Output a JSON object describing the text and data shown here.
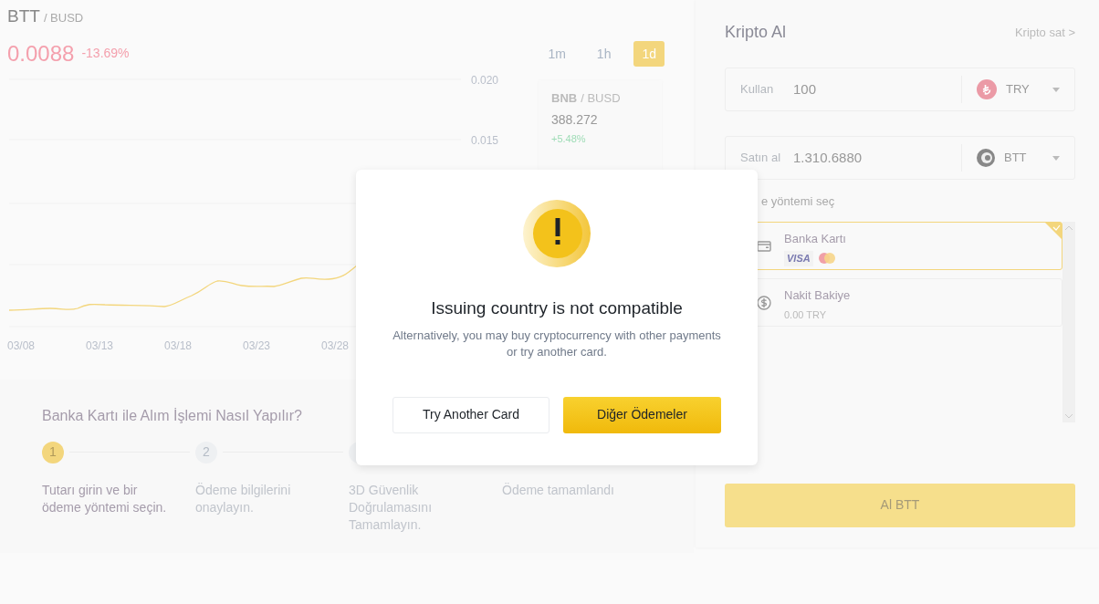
{
  "pair": {
    "base": "BTT",
    "quote": "/ BUSD",
    "price": "0.0088",
    "change": "-13.69%"
  },
  "intervals": [
    {
      "label": "1m",
      "selected": false
    },
    {
      "label": "1h",
      "selected": false
    },
    {
      "label": "1d",
      "selected": true
    }
  ],
  "chart": {
    "y_ticks": [
      "0.020",
      "0.015"
    ],
    "x_labels": [
      "03/08",
      "03/13",
      "03/18",
      "03/23",
      "03/28"
    ]
  },
  "ticker": {
    "base": "BNB",
    "quote": "/ BUSD",
    "price": "388.272",
    "change": "+5.48%"
  },
  "guide": {
    "title": "Banka Kartı ile Alım İşlemi Nasıl Yapılır?",
    "steps": [
      {
        "number": "1",
        "text": "Tutarı girin ve bir ödeme yöntemi seçin.",
        "active": true
      },
      {
        "number": "2",
        "text": "Ödeme bilgilerini onaylayın.",
        "active": false
      },
      {
        "text": "3D Güvenlik Doğrulamasını Tamamlayın.",
        "active": false
      },
      {
        "text": "Ödeme tamamlandı",
        "active": false
      }
    ]
  },
  "buy_panel": {
    "title": "Kripto Al",
    "sell_link": "Kripto sat >",
    "spend": {
      "label": "Kullan",
      "value": "100",
      "currency": "TRY"
    },
    "receive": {
      "label": "Satın al",
      "value": "1.310.6880",
      "currency": "BTT"
    },
    "method_label": "e yöntemi seç",
    "methods": [
      {
        "kind": "card",
        "name": "Banka Kartı",
        "brand": "VISA",
        "selected": true
      },
      {
        "kind": "balance",
        "name": "Nakit Bakiye",
        "balance": "0.00 TRY",
        "selected": false
      }
    ],
    "submit": "Al BTT"
  },
  "dialog": {
    "title": "Issuing country is not compatible",
    "message": "Alternatively, you may buy cryptocurrency with other payments or try another card.",
    "secondary": "Try Another Card",
    "primary": "Diğer Ödemeler"
  }
}
